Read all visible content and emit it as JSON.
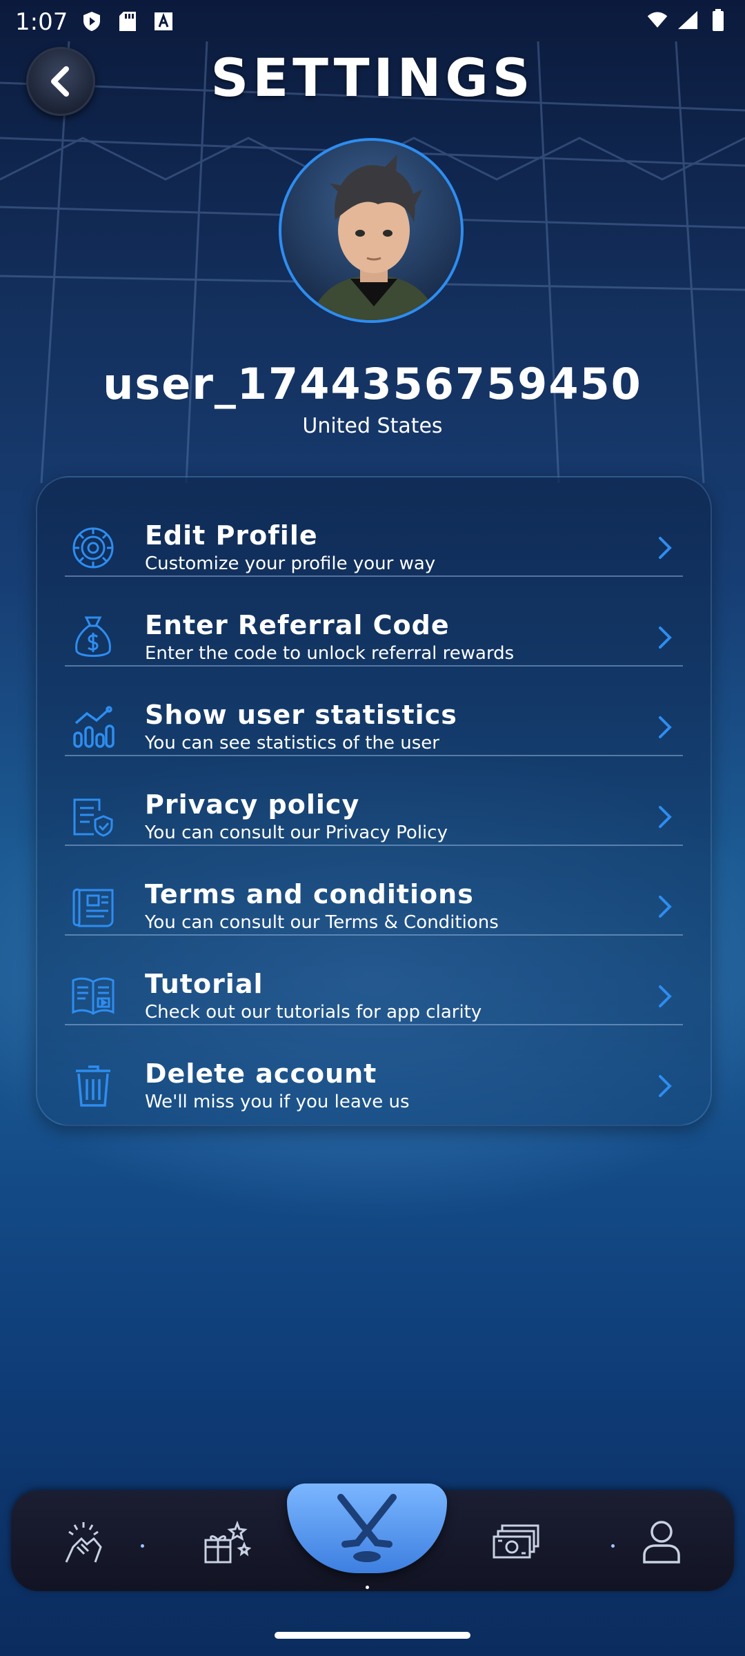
{
  "status_bar": {
    "time": "1:07"
  },
  "header": {
    "title": "SETTINGS",
    "back_icon": "chevron-left-icon"
  },
  "profile": {
    "username": "user_1744356759450",
    "country": "United States"
  },
  "menu": {
    "items": [
      {
        "title": "Edit Profile",
        "subtitle": "Customize your profile your way",
        "icon": "gear-icon"
      },
      {
        "title": "Enter Referral Code",
        "subtitle": "Enter the code to unlock referral rewards",
        "icon": "money-bag-icon"
      },
      {
        "title": "Show user statistics",
        "subtitle": "You can see statistics of the user",
        "icon": "stats-chart-icon"
      },
      {
        "title": "Privacy policy",
        "subtitle": "You can consult our Privacy Policy",
        "icon": "document-shield-icon"
      },
      {
        "title": "Terms and conditions",
        "subtitle": "You can consult our Terms & Conditions",
        "icon": "scroll-icon"
      },
      {
        "title": "Tutorial",
        "subtitle": "Check out our tutorials for app clarity",
        "icon": "book-icon"
      },
      {
        "title": "Delete account",
        "subtitle": "We'll miss you if you leave us",
        "icon": "trash-icon"
      }
    ]
  },
  "bottom_nav": {
    "items": [
      "handshake-icon",
      "gifts-icon",
      "hockey-sticks-icon",
      "cash-icon",
      "user-icon"
    ],
    "active": "hockey-sticks-icon"
  },
  "colors": {
    "accent": "#2e8df0",
    "card": "#133a6e",
    "nav": "#171a2c"
  }
}
